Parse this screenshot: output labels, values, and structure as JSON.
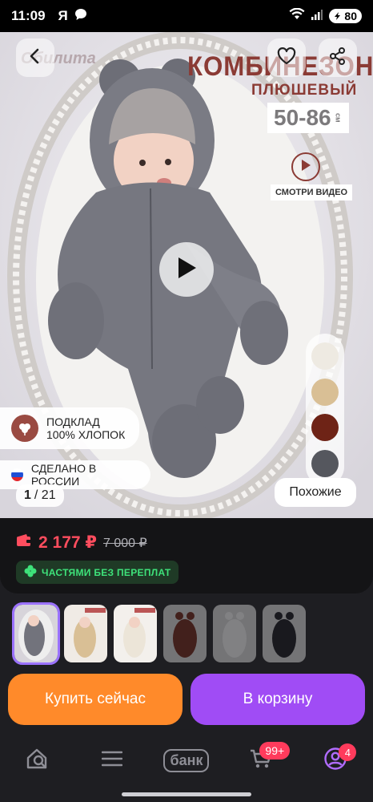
{
  "status": {
    "time": "11:09",
    "ya": "Я",
    "battery": "80"
  },
  "hero": {
    "brand": "Обилита",
    "title": "КОМБИНЕЗОН",
    "subtitle": "ПЛЮШЕВЫЙ",
    "sizes": "50-86",
    "sizes_unit": "см",
    "video_label": "СМОТРИ ВИДЕО",
    "lining_line1": "ПОДКЛАД",
    "lining_line2": "100% ХЛОПОК",
    "made_in": "СДЕЛАНО В РОССИИ",
    "counter_current": "1",
    "counter_total": "/ 21",
    "similar": "Похожие",
    "swatch_colors": [
      "#eeeae2",
      "#d9bf95",
      "#6e2316",
      "#55575e"
    ]
  },
  "price": {
    "current": "2 177 ₽",
    "old": "7 000 ₽",
    "installments": "ЧАСТЯМИ БЕЗ ПЕРЕПЛАТ"
  },
  "actions": {
    "buy_now": "Купить сейчас",
    "add_to_cart": "В корзину"
  },
  "nav": {
    "bank": "банк",
    "cart_badge": "99+",
    "profile_badge": "4"
  },
  "colors": {
    "buy": "#ff8a2a",
    "cart": "#a04cf5",
    "price": "#ff4d5e",
    "installments": "#3ee27a"
  }
}
